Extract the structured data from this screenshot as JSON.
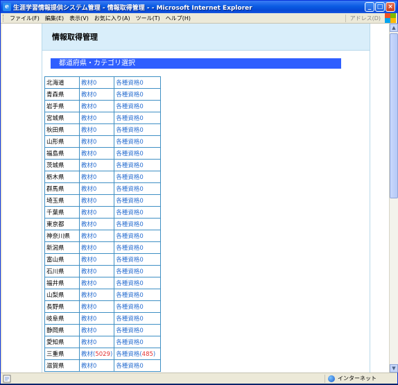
{
  "window": {
    "title": "生涯学習情報提供システム管理 - 情報取得管理 - - Microsoft Internet Explorer",
    "controls": {
      "minimize": "_",
      "maximize": "□",
      "close": "×"
    }
  },
  "menu": {
    "items": [
      "ファイル(F)",
      "編集(E)",
      "表示(V)",
      "お気に入り(A)",
      "ツール(T)",
      "ヘルプ(H)"
    ],
    "address_label": "アドレス(D)"
  },
  "page": {
    "header_title": "情報取得管理",
    "section_title": "都道府県・カテゴリ選択"
  },
  "prefectures": [
    {
      "name": "北海道",
      "material_label": "教材0",
      "qualification_label": "各種資格0"
    },
    {
      "name": "青森県",
      "material_label": "教材0",
      "qualification_label": "各種資格0"
    },
    {
      "name": "岩手県",
      "material_label": "教材0",
      "qualification_label": "各種資格0"
    },
    {
      "name": "宮城県",
      "material_label": "教材0",
      "qualification_label": "各種資格0"
    },
    {
      "name": "秋田県",
      "material_label": "教材0",
      "qualification_label": "各種資格0"
    },
    {
      "name": "山形県",
      "material_label": "教材0",
      "qualification_label": "各種資格0"
    },
    {
      "name": "福島県",
      "material_label": "教材0",
      "qualification_label": "各種資格0"
    },
    {
      "name": "茨城県",
      "material_label": "教材0",
      "qualification_label": "各種資格0"
    },
    {
      "name": "栃木県",
      "material_label": "教材0",
      "qualification_label": "各種資格0"
    },
    {
      "name": "群馬県",
      "material_label": "教材0",
      "qualification_label": "各種資格0"
    },
    {
      "name": "埼玉県",
      "material_label": "教材0",
      "qualification_label": "各種資格0"
    },
    {
      "name": "千葉県",
      "material_label": "教材0",
      "qualification_label": "各種資格0"
    },
    {
      "name": "東京都",
      "material_label": "教材0",
      "qualification_label": "各種資格0"
    },
    {
      "name": "神奈川県",
      "material_label": "教材0",
      "qualification_label": "各種資格0"
    },
    {
      "name": "新潟県",
      "material_label": "教材0",
      "qualification_label": "各種資格0"
    },
    {
      "name": "富山県",
      "material_label": "教材0",
      "qualification_label": "各種資格0"
    },
    {
      "name": "石川県",
      "material_label": "教材0",
      "qualification_label": "各種資格0"
    },
    {
      "name": "福井県",
      "material_label": "教材0",
      "qualification_label": "各種資格0"
    },
    {
      "name": "山梨県",
      "material_label": "教材0",
      "qualification_label": "各種資格0"
    },
    {
      "name": "長野県",
      "material_label": "教材0",
      "qualification_label": "各種資格0"
    },
    {
      "name": "岐阜県",
      "material_label": "教材0",
      "qualification_label": "各種資格0"
    },
    {
      "name": "静岡県",
      "material_label": "教材0",
      "qualification_label": "各種資格0"
    },
    {
      "name": "愛知県",
      "material_label": "教材0",
      "qualification_label": "各種資格0"
    },
    {
      "name": "三重県",
      "material_label": "教材",
      "material_count": "5029",
      "qualification_label": "各種資格",
      "qualification_count": "485"
    },
    {
      "name": "滋賀県",
      "material_label": "教材0",
      "qualification_label": "各種資格0"
    }
  ],
  "status": {
    "zone": "インターネット"
  },
  "colors": {
    "link": "#2a6fd0",
    "count_highlight": "#e23030",
    "section_bar": "#2f5fff",
    "header_bg": "#d9eefa"
  }
}
